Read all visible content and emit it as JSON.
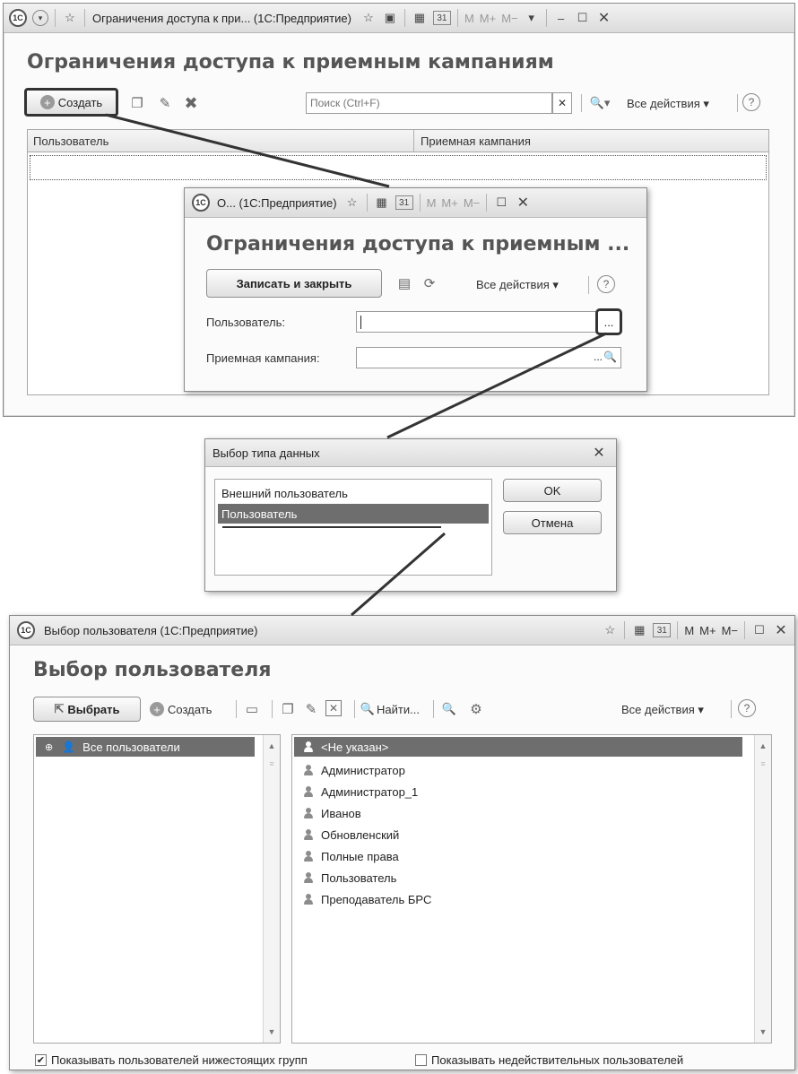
{
  "main_window": {
    "title": "Ограничения доступа к при... (1С:Предприятие)",
    "heading": "Ограничения доступа к приемным кампаниям",
    "create_label": "Создать",
    "search_placeholder": "Поиск (Ctrl+F)",
    "all_actions": "Все действия ▾",
    "columns": [
      "Пользователь",
      "Приемная кампания"
    ],
    "mem_buttons": [
      "M",
      "M+",
      "M−"
    ]
  },
  "record_window": {
    "title": "О... (1С:Предприятие)",
    "heading": "Ограничения доступа к приемным ...",
    "save_close_label": "Записать и закрыть",
    "all_actions": "Все действия ▾",
    "user_label": "Пользователь:",
    "campaign_label": "Приемная кампания:",
    "choose_button": "...",
    "mem_buttons": [
      "M",
      "M+",
      "M−"
    ]
  },
  "type_dialog": {
    "title": "Выбор типа данных",
    "items": [
      "Внешний пользователь",
      "Пользователь"
    ],
    "selected_index": 1,
    "ok_label": "OK",
    "cancel_label": "Отмена"
  },
  "user_select_window": {
    "title": "Выбор пользователя  (1С:Предприятие)",
    "heading": "Выбор пользователя",
    "select_label": "Выбрать",
    "create_label": "Создать",
    "find_label": "Найти...",
    "all_actions": "Все действия ▾",
    "mem_buttons": [
      "M",
      "M+",
      "M−"
    ],
    "groups": [
      "Все пользователи"
    ],
    "users": [
      "<Не указан>",
      "Администратор",
      "Администратор_1",
      "Иванов",
      "Обновленский",
      "Полные права",
      "Пользователь",
      "Преподаватель БРС"
    ],
    "selected_user_index": 0,
    "show_subgroups_label": "Показывать пользователей нижестоящих групп",
    "show_subgroups_checked": true,
    "show_inactive_label": "Показывать недействительных пользователей",
    "show_inactive_checked": false
  },
  "logo_text": "1C"
}
